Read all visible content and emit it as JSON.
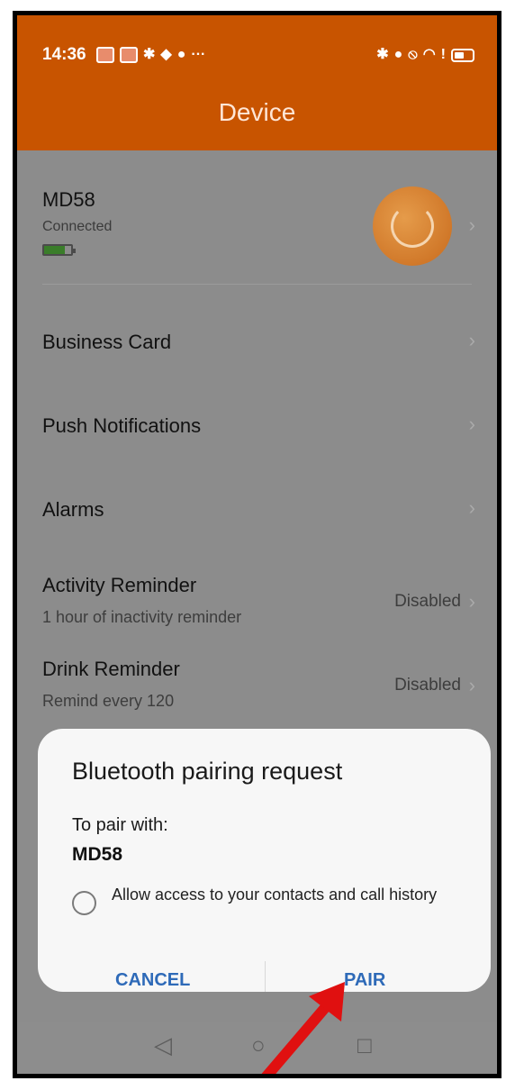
{
  "status_bar": {
    "time": "14:36",
    "more": "···"
  },
  "header": {
    "title": "Device"
  },
  "device": {
    "name": "MD58",
    "status": "Connected"
  },
  "menu": [
    {
      "label": "Business Card"
    },
    {
      "label": "Push Notifications"
    },
    {
      "label": "Alarms"
    },
    {
      "label": "Activity Reminder",
      "sub": "1 hour of inactivity reminder",
      "value": "Disabled"
    },
    {
      "label": "Drink Reminder",
      "sub": "Remind every 120",
      "value": "Disabled"
    }
  ],
  "dialog": {
    "title": "Bluetooth pairing request",
    "text": "To pair with:",
    "device": "MD58",
    "checkbox_label": "Allow access to your contacts and call history",
    "cancel": "CANCEL",
    "pair": "PAIR"
  },
  "colors": {
    "header": "#c85400",
    "accent": "#2e6ab8",
    "annotation": "#e01010"
  }
}
